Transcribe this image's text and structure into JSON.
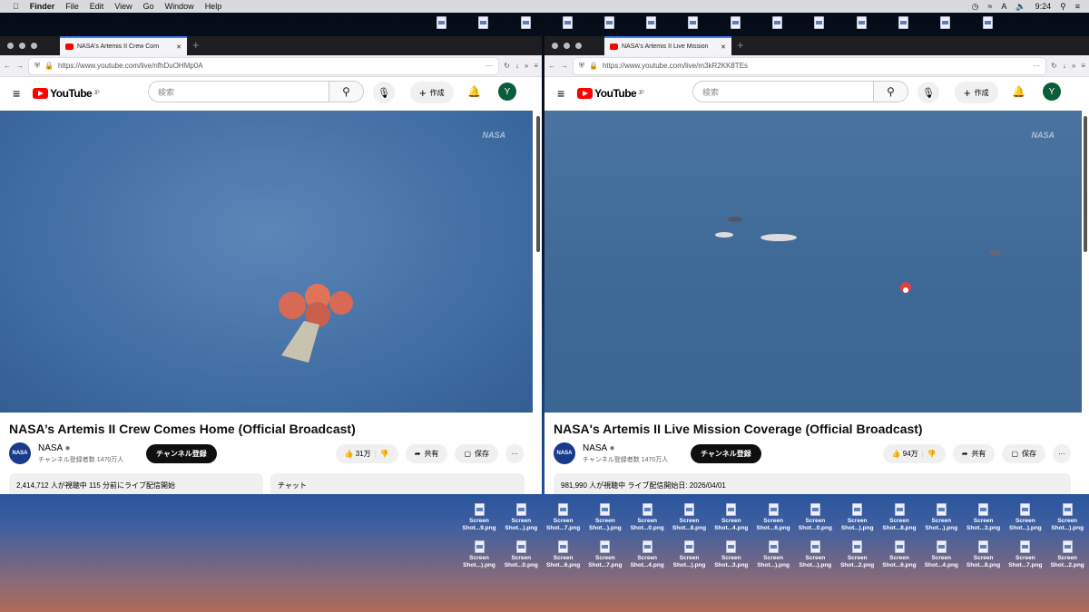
{
  "menubar": {
    "app": "Finder",
    "items": [
      "File",
      "Edit",
      "View",
      "Go",
      "Window",
      "Help"
    ],
    "time": "9:24"
  },
  "windows": [
    {
      "tab_title": "NASA's Artemis II Crew Com",
      "url": "https://www.youtube.com/live/nfhDuOHMp0A",
      "search_placeholder": "検索",
      "create": "作成",
      "avatar": "Y",
      "logo": "YouTube",
      "region": "JP",
      "video_title": "NASA’s Artemis II Crew Comes Home (Official Broadcast)",
      "channel": "NASA",
      "subscribers": "チャンネル登録者数 1470万人",
      "subscribe": "チャンネル登録",
      "likes": "31万",
      "share": "共有",
      "save": "保存",
      "info": "2,414,712 人が視聴中  115 分前にライブ配信開始",
      "chat": "チャット"
    },
    {
      "tab_title": "NASA's Artemis II Live Mission",
      "url": "https://www.youtube.com/live/m3kR2KK8TEs",
      "search_placeholder": "検索",
      "create": "作成",
      "avatar": "Y",
      "logo": "YouTube",
      "region": "JP",
      "video_title": "NASA's Artemis II Live Mission Coverage (Official Broadcast)",
      "channel": "NASA",
      "subscribers": "チャンネル登録者数 1470万人",
      "subscribe": "チャンネル登録",
      "likes": "94万",
      "share": "共有",
      "save": "保存",
      "info": "981,990 人が視聴中  ライブ配信開始日: 2026/04/01"
    }
  ],
  "desktop": {
    "row1": [
      "Shot...9.png",
      "Shot...).png",
      "Shot...7.png",
      "Shot...).png",
      "Shot...0.png",
      "Shot...8.png",
      "Shot...4.png",
      "Shot...6.png",
      "Shot...0.png",
      "Shot...).png",
      "Shot...8.png",
      "Shot...).png",
      "Shot...3.png",
      "Shot...).png",
      "Shot...).png"
    ],
    "row2": [
      "Shot...).png",
      "Shot...0.png",
      "Shot...6.png",
      "Shot...7.png",
      "Shot...4.png",
      "Shot...).png",
      "Shot...3.png",
      "Shot...).png",
      "Shot...).png",
      "Shot...2.png",
      "Shot...6.png",
      "Shot...4.png",
      "Shot...8.png",
      "Shot...7.png",
      "Shot...2.png"
    ],
    "prefix": "Screen"
  }
}
